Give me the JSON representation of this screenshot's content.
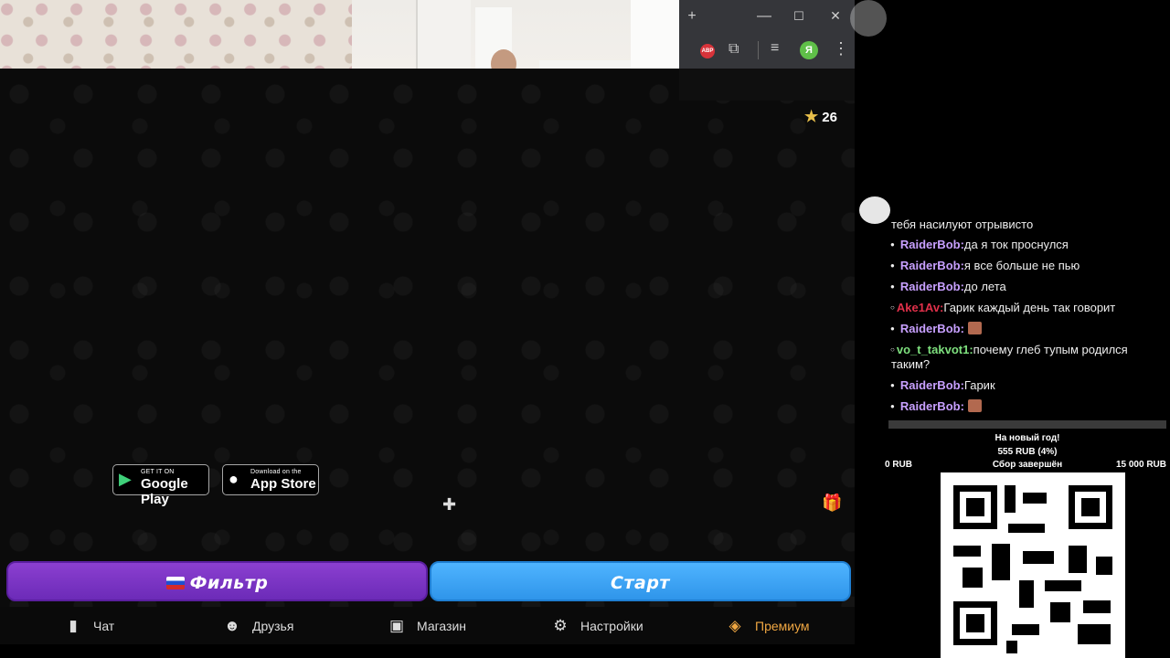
{
  "browser": {
    "new_tab": "+",
    "minimize": "—",
    "maximize": "☐",
    "close": "✕",
    "abp_label": "ABP",
    "profile_initial": "Я"
  },
  "stars": {
    "count": "26"
  },
  "stores": {
    "google_small": "GET IT ON",
    "google_big": "Google Play",
    "apple_small": "Download on the",
    "apple_big": "App Store"
  },
  "buttons": {
    "filter": "Фильтр",
    "start": "Старт"
  },
  "nav": [
    {
      "label": "Чат",
      "icon": "chat-icon"
    },
    {
      "label": "Друзья",
      "icon": "friends-icon"
    },
    {
      "label": "Магазин",
      "icon": "shop-icon"
    },
    {
      "label": "Настройки",
      "icon": "gear-icon"
    },
    {
      "label": "Премиум",
      "icon": "tag-icon"
    }
  ],
  "chat": [
    {
      "nick": "",
      "text": "тебя насилуют отрывисто",
      "color": "#ffffff"
    },
    {
      "nick": "RaiderBob:",
      "text": "да я ток проснулся",
      "color": "#c8a0ff"
    },
    {
      "nick": "RaiderBob:",
      "text": "я все больше не пью",
      "color": "#c8a0ff"
    },
    {
      "nick": "RaiderBob:",
      "text": "до лета",
      "color": "#c8a0ff"
    },
    {
      "nick": "Ake1Av:",
      "text": "Гарик каждый день так говорит",
      "color": "#e0304a"
    },
    {
      "nick": "RaiderBob:",
      "text": "",
      "color": "#c8a0ff",
      "emote": true
    },
    {
      "nick": "vo_t_takvot1:",
      "text": "почему глеб тупым родился",
      "color": "#7ee07e"
    },
    {
      "nick": "",
      "text": "таким?",
      "color": "#ffffff"
    },
    {
      "nick": "RaiderBob:",
      "text": "Гарик",
      "color": "#c8a0ff"
    },
    {
      "nick": "RaiderBob:",
      "text": "",
      "color": "#c8a0ff",
      "emote": true
    }
  ],
  "goal": {
    "title": "На новый год!",
    "amount": "555 RUB (4%)",
    "min": "0 RUB",
    "status": "Сбор завершён",
    "max": "15 000 RUB"
  },
  "colors": {
    "filter": "#7a33c4",
    "start": "#3aa3f5",
    "premium": "#f0a742",
    "star": "#e8bf4a"
  }
}
